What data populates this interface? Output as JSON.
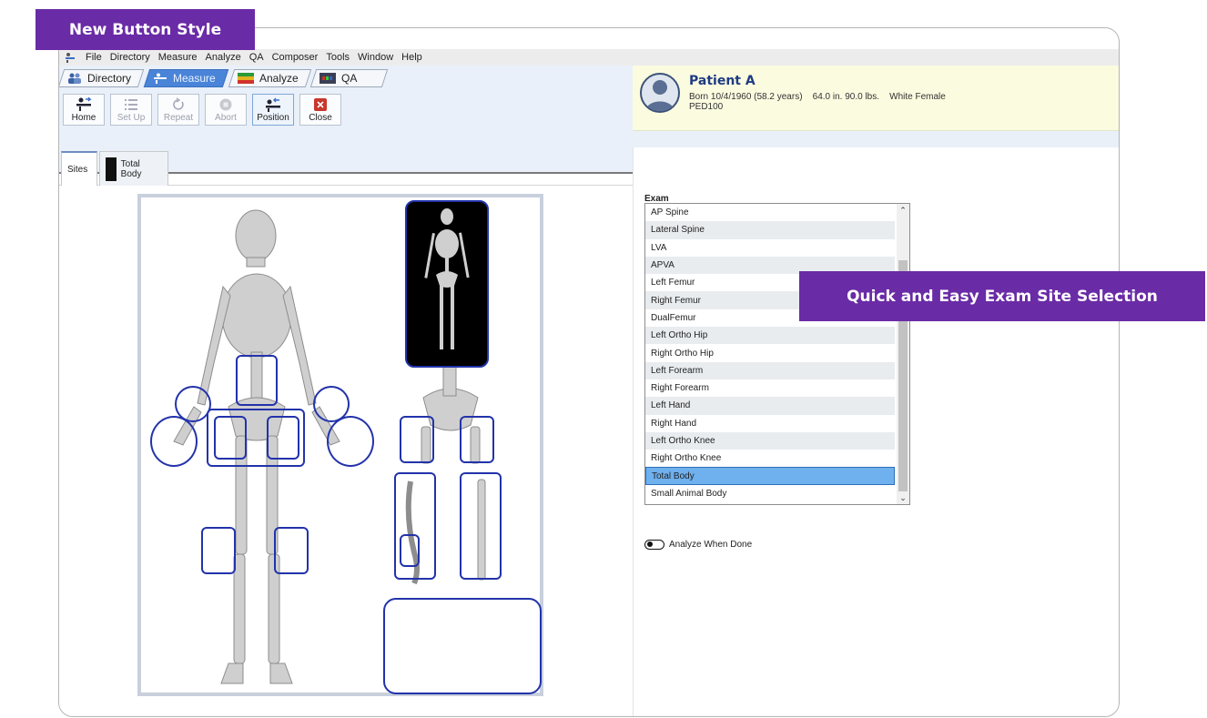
{
  "callouts": {
    "top": "New Button Style",
    "right": "Quick and Easy Exam Site Selection"
  },
  "menu": [
    "File",
    "Directory",
    "Measure",
    "Analyze",
    "QA",
    "Composer",
    "Tools",
    "Window",
    "Help"
  ],
  "tabs": [
    {
      "label": "Directory",
      "icon": "people-icon"
    },
    {
      "label": "Measure",
      "icon": "measure-icon",
      "active": true
    },
    {
      "label": "Analyze",
      "icon": "analyze-icon"
    },
    {
      "label": "QA",
      "icon": "qa-icon"
    }
  ],
  "toolbar": {
    "home": "Home",
    "setup": "Set Up",
    "repeat": "Repeat",
    "abort": "Abort",
    "position": "Position",
    "close": "Close"
  },
  "patient": {
    "name": "Patient A",
    "details": "Born 10/4/1960 (58.2 years)    64.0 in. 90.0 lbs.    White Female",
    "id": "PED100"
  },
  "subtabs": {
    "sites": "Sites",
    "total_body": "Total Body"
  },
  "exam": {
    "label": "Exam",
    "items": [
      "AP Spine",
      "Lateral Spine",
      "LVA",
      "APVA",
      "Left Femur",
      "Right Femur",
      "DualFemur",
      "Left Ortho Hip",
      "Right Ortho Hip",
      "Left Forearm",
      "Right Forearm",
      "Left Hand",
      "Right Hand",
      "Left Ortho Knee",
      "Right Ortho Knee",
      "Total Body",
      "Small Animal Body"
    ],
    "selected": "Total Body"
  },
  "options": {
    "analyze_when_done": "Analyze When Done"
  },
  "colors": {
    "callout": "#6a2ba6",
    "selection": "#6fb0ee",
    "site_outline": "#2233aa",
    "patient_bg": "#fbfbe0"
  }
}
